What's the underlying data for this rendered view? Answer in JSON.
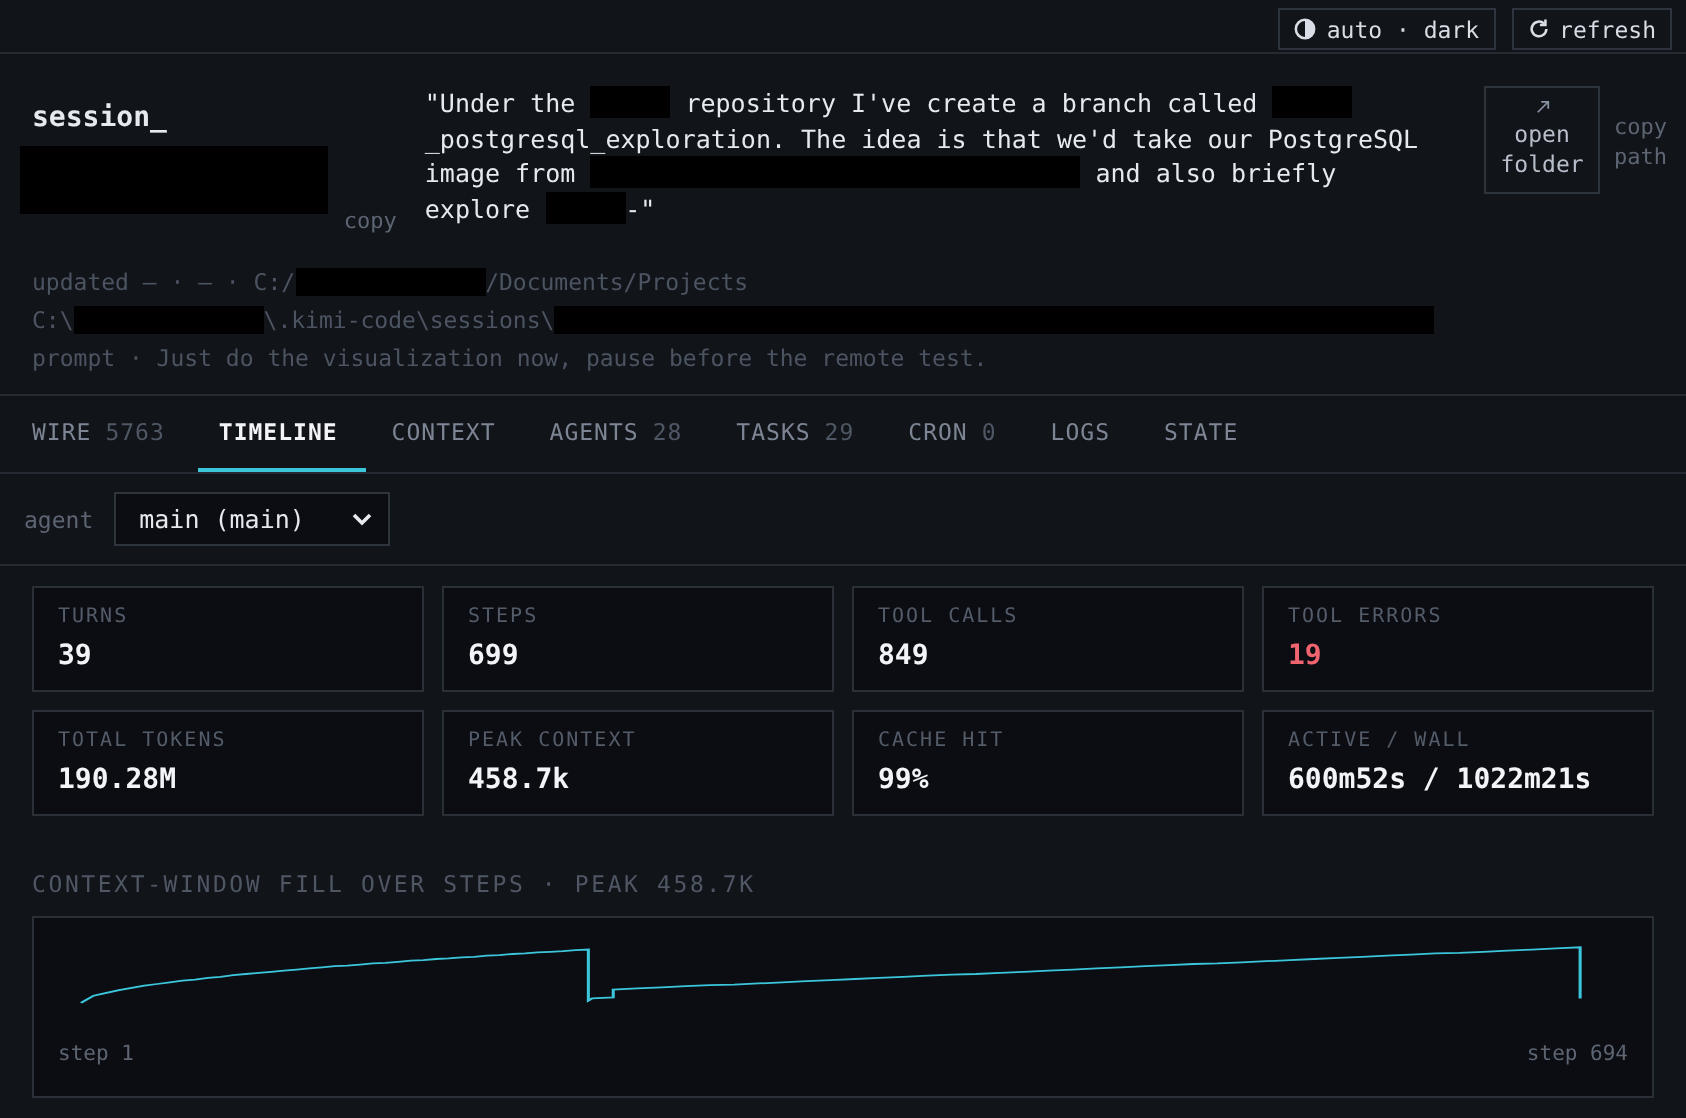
{
  "toolbar": {
    "theme": "auto · dark",
    "refresh": "refresh"
  },
  "session": {
    "name": "session_",
    "copy": "copy",
    "quote": [
      {
        "kind": "text",
        "text": "\"Under the "
      },
      {
        "kind": "redacted"
      },
      {
        "kind": "text",
        "text": " repository I've create a branch called "
      },
      {
        "kind": "redacted"
      },
      {
        "kind": "text",
        "text": "_postgresql_exploration. The idea is that we'd take our PostgreSQL image from "
      },
      {
        "kind": "redacted"
      },
      {
        "kind": "text",
        "text": " and also briefly explore "
      },
      {
        "kind": "redacted"
      },
      {
        "kind": "text",
        "text": "-\""
      }
    ],
    "open_folder": "open folder",
    "copy_path": "copy path",
    "meta": [
      [
        {
          "kind": "text",
          "text": "updated — · —  · C:/"
        },
        {
          "kind": "redacted"
        },
        {
          "kind": "text",
          "text": "/Documents/Projects"
        }
      ],
      [
        {
          "kind": "text",
          "text": "C:\\"
        },
        {
          "kind": "redacted"
        },
        {
          "kind": "text",
          "text": "\\.kimi-code\\sessions\\"
        },
        {
          "kind": "redacted"
        }
      ],
      [
        {
          "kind": "text",
          "text": "prompt · Just do the visualization now, pause before the remote test."
        }
      ]
    ]
  },
  "tabs": [
    {
      "label": "WIRE",
      "count": "5763",
      "selected": false
    },
    {
      "label": "TIMELINE",
      "selected": true
    },
    {
      "label": "CONTEXT",
      "selected": false
    },
    {
      "label": "AGENTS",
      "count": "28",
      "selected": false
    },
    {
      "label": "TASKS",
      "count": "29",
      "selected": false
    },
    {
      "label": "CRON",
      "count": "0",
      "selected": false
    },
    {
      "label": "LOGS",
      "selected": false
    },
    {
      "label": "STATE",
      "selected": false
    }
  ],
  "agent": {
    "label": "agent",
    "value": "main (main)"
  },
  "stats": [
    {
      "label": "TURNS",
      "value": "39",
      "kind": "normal"
    },
    {
      "label": "STEPS",
      "value": "699",
      "kind": "normal"
    },
    {
      "label": "TOOL CALLS",
      "value": "849",
      "kind": "normal"
    },
    {
      "label": "TOOL ERRORS",
      "value": "19",
      "kind": "error"
    },
    {
      "label": "TOTAL TOKENS",
      "value": "190.28M",
      "kind": "normal"
    },
    {
      "label": "PEAK CONTEXT",
      "value": "458.7k",
      "kind": "normal"
    },
    {
      "label": "CACHE HIT",
      "value": "99%",
      "kind": "normal"
    },
    {
      "label": "ACTIVE / WALL",
      "value": "600m52s / 1022m21s",
      "kind": "normal"
    }
  ],
  "chart": {
    "title": "CONTEXT-WINDOW FILL OVER STEPS · PEAK 458.7K",
    "start": "step 1",
    "end": "step 694"
  }
}
